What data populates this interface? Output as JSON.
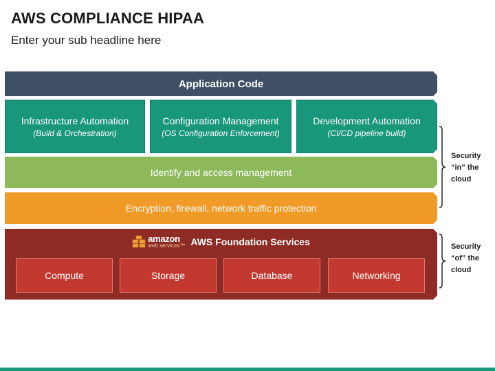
{
  "header": {
    "title": "AWS COMPLIANCE HIPAA",
    "subtitle": "Enter your sub headline here"
  },
  "layers": {
    "application": "Application Code",
    "automation": [
      {
        "main": "Infrastructure Automation",
        "sub": "(Build & Orchestration)"
      },
      {
        "main": "Configuration Management",
        "sub": "(OS Configuration Enforcement)"
      },
      {
        "main": "Development Automation",
        "sub": "(CI/CD pipeline build)"
      }
    ],
    "identity": "Identify and access management",
    "encryption": "Encryption, firewall, network traffic protection"
  },
  "foundation": {
    "logo_word": "amazon",
    "logo_sub": "web services™",
    "title": "AWS Foundation Services",
    "services": [
      "Compute",
      "Storage",
      "Database",
      "Networking"
    ]
  },
  "side_labels": {
    "in_cloud": [
      "Security",
      "“in” the",
      "cloud"
    ],
    "of_cloud": [
      "Security",
      "“of” the",
      "cloud"
    ]
  },
  "colors": {
    "application": "#3f5064",
    "automation": "#19977a",
    "identity": "#8db95a",
    "encryption": "#f09a28",
    "foundation": "#8e2b25",
    "service": "#c4392f",
    "aws_orange": "#f3a13b"
  }
}
